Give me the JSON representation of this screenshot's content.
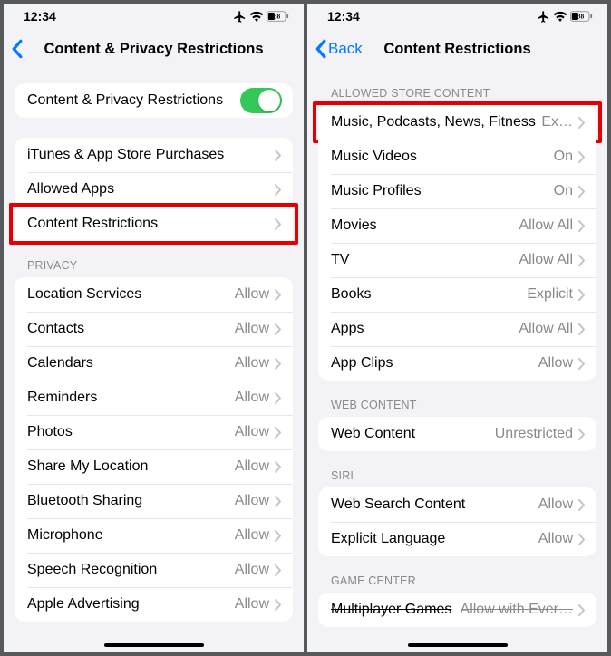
{
  "status": {
    "time": "12:34",
    "battery": "38"
  },
  "left": {
    "title": "Content & Privacy Restrictions",
    "toggle_label": "Content & Privacy Restrictions",
    "g1": {
      "itunes": "iTunes & App Store Purchases",
      "allowed_apps": "Allowed Apps",
      "content_restrictions": "Content Restrictions"
    },
    "privacy_header": "PRIVACY",
    "privacy": {
      "location": {
        "label": "Location Services",
        "value": "Allow"
      },
      "contacts": {
        "label": "Contacts",
        "value": "Allow"
      },
      "calendars": {
        "label": "Calendars",
        "value": "Allow"
      },
      "reminders": {
        "label": "Reminders",
        "value": "Allow"
      },
      "photos": {
        "label": "Photos",
        "value": "Allow"
      },
      "share_loc": {
        "label": "Share My Location",
        "value": "Allow"
      },
      "bluetooth": {
        "label": "Bluetooth Sharing",
        "value": "Allow"
      },
      "microphone": {
        "label": "Microphone",
        "value": "Allow"
      },
      "speech": {
        "label": "Speech Recognition",
        "value": "Allow"
      },
      "ads": {
        "label": "Apple Advertising",
        "value": "Allow"
      }
    }
  },
  "right": {
    "back_label": "Back",
    "title": "Content Restrictions",
    "allowed_header": "ALLOWED STORE CONTENT",
    "store": {
      "music": {
        "label": "Music, Podcasts, News, Fitness",
        "value": "Ex…"
      },
      "music_videos": {
        "label": "Music Videos",
        "value": "On"
      },
      "music_profiles": {
        "label": "Music Profiles",
        "value": "On"
      },
      "movies": {
        "label": "Movies",
        "value": "Allow All"
      },
      "tv": {
        "label": "TV",
        "value": "Allow All"
      },
      "books": {
        "label": "Books",
        "value": "Explicit"
      },
      "apps": {
        "label": "Apps",
        "value": "Allow All"
      },
      "app_clips": {
        "label": "App Clips",
        "value": "Allow"
      }
    },
    "web_header": "WEB CONTENT",
    "web": {
      "label": "Web Content",
      "value": "Unrestricted"
    },
    "siri_header": "SIRI",
    "siri": {
      "search": {
        "label": "Web Search Content",
        "value": "Allow"
      },
      "explicit": {
        "label": "Explicit Language",
        "value": "Allow"
      }
    },
    "gc_header": "GAME CENTER",
    "gc": {
      "multi": {
        "label": "Multiplayer Games",
        "value": "Allow with Ever…"
      }
    }
  }
}
